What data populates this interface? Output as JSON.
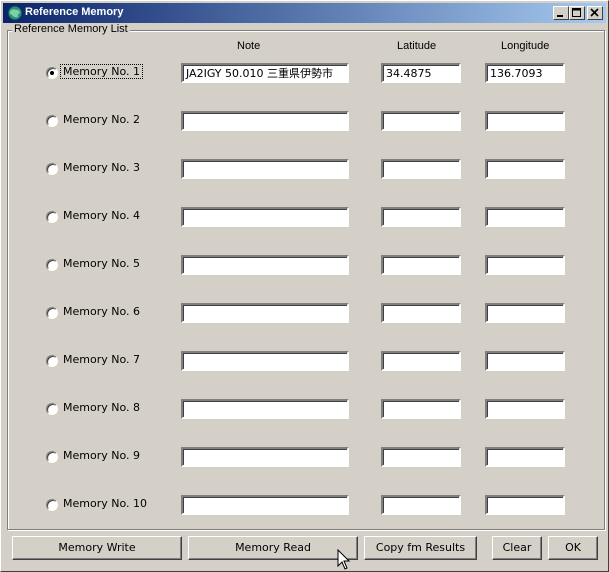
{
  "window": {
    "title": "Reference Memory",
    "group_label": "Reference Memory List"
  },
  "columns": {
    "note": "Note",
    "latitude": "Latitude",
    "longitude": "Longitude"
  },
  "rows": [
    {
      "label": "Memory No. 1",
      "note": "JA2IGY 50.010 三重県伊勢市",
      "lat": "34.4875",
      "lon": "136.7093",
      "selected": true
    },
    {
      "label": "Memory No. 2",
      "note": "",
      "lat": "",
      "lon": "",
      "selected": false
    },
    {
      "label": "Memory No. 3",
      "note": "",
      "lat": "",
      "lon": "",
      "selected": false
    },
    {
      "label": "Memory No. 4",
      "note": "",
      "lat": "",
      "lon": "",
      "selected": false
    },
    {
      "label": "Memory No. 5",
      "note": "",
      "lat": "",
      "lon": "",
      "selected": false
    },
    {
      "label": "Memory No. 6",
      "note": "",
      "lat": "",
      "lon": "",
      "selected": false
    },
    {
      "label": "Memory No. 7",
      "note": "",
      "lat": "",
      "lon": "",
      "selected": false
    },
    {
      "label": "Memory No. 8",
      "note": "",
      "lat": "",
      "lon": "",
      "selected": false
    },
    {
      "label": "Memory No. 9",
      "note": "",
      "lat": "",
      "lon": "",
      "selected": false
    },
    {
      "label": "Memory No. 10",
      "note": "",
      "lat": "",
      "lon": "",
      "selected": false
    }
  ],
  "buttons": {
    "memory_write": "Memory Write",
    "memory_read": "Memory Read",
    "copy_results": "Copy fm Results",
    "clear": "Clear",
    "ok": "OK"
  },
  "icons": {
    "app": "globe-icon",
    "minimize": "minimize-icon",
    "maximize": "maximize-icon",
    "close": "close-icon",
    "cursor": "mouse-pointer-icon"
  }
}
